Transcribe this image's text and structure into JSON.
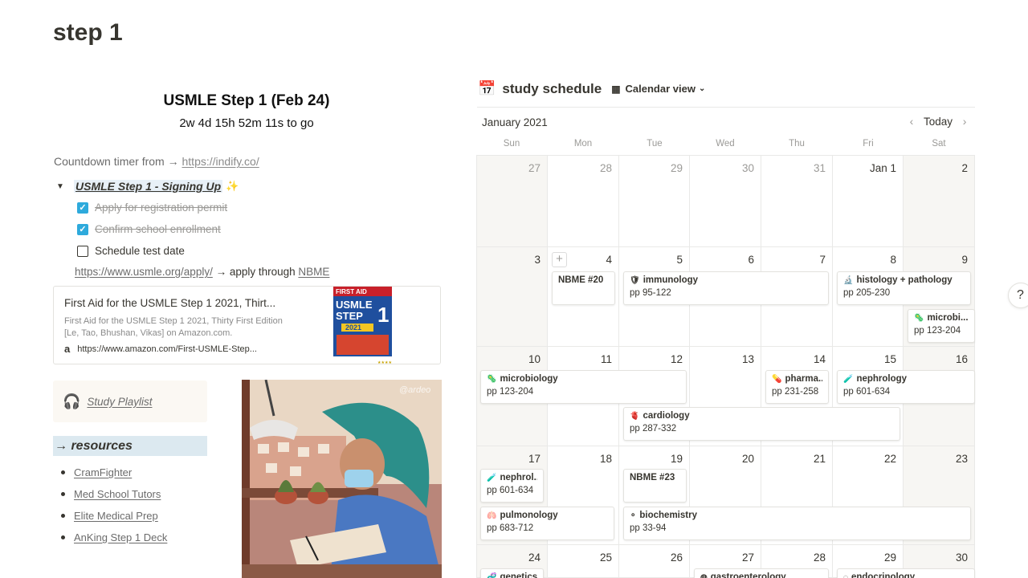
{
  "page": {
    "title": "step 1"
  },
  "countdown": {
    "title": "USMLE Step 1 (Feb 24)",
    "value": "2w 4d 15h 52m 11s to go",
    "source_prefix": "Countdown timer from → ",
    "source_link": "https://indify.co/"
  },
  "signup": {
    "toggle_label": "USMLE Step 1 - Signing Up",
    "toggle_icon": "sparkles-icon",
    "todos": [
      {
        "label": "Apply for registration permit",
        "checked": true
      },
      {
        "label": "Confirm school enrollment",
        "checked": true
      },
      {
        "label": "Schedule test date",
        "checked": false
      }
    ],
    "apply_link": "https://www.usmle.org/apply/",
    "apply_mid": " → apply through ",
    "apply_nbme": "NBME"
  },
  "bookmark": {
    "title": "First Aid for the USMLE Step 1 2021, Thirt...",
    "description": "First Aid for the USMLE Step 1 2021, Thirty First Edition [Le, Tao, Bhushan, Vikas] on Amazon.com.",
    "url": "https://www.amazon.com/First-USMLE-Step...",
    "cover_top": "FIRST AID",
    "cover_mid": "USMLE",
    "cover_step": "STEP",
    "cover_num": "1",
    "cover_year": "2021"
  },
  "playlist": {
    "label": "Study Playlist",
    "icon": "headphones-icon"
  },
  "resources": {
    "heading": "→ resources",
    "items": [
      "CramFighter",
      "Med School Tutors",
      "Elite Medical Prep",
      "AnKing Step 1 Deck"
    ]
  },
  "artwork": {
    "signature": "@ardeo"
  },
  "calendar": {
    "db_title": "study schedule",
    "view_label": "Calendar view",
    "month": "January 2021",
    "today_label": "Today",
    "weekdays": [
      "Sun",
      "Mon",
      "Tue",
      "Wed",
      "Thu",
      "Fri",
      "Sat"
    ],
    "weeks": [
      [
        "27",
        "28",
        "29",
        "30",
        "31",
        "Jan 1",
        "2"
      ],
      [
        "3",
        "4",
        "5",
        "6",
        "7",
        "8",
        "9"
      ],
      [
        "10",
        "11",
        "12",
        "13",
        "14",
        "15",
        "16"
      ],
      [
        "17",
        "18",
        "19",
        "20",
        "21",
        "22",
        "23"
      ],
      [
        "24",
        "25",
        "26",
        "27",
        "28",
        "29",
        "30"
      ]
    ],
    "events": [
      {
        "title": "NBME #20",
        "pages": ""
      },
      {
        "title": "immunology",
        "pages": "pp 95-122",
        "icon": "shield-icon"
      },
      {
        "title": "histology + pathology",
        "pages": "pp 205-230",
        "icon": "microscope-icon"
      },
      {
        "title": "microbi...",
        "pages": "pp 123-204",
        "icon": "microbe-icon"
      },
      {
        "title": "microbiology",
        "pages": "pp 123-204",
        "icon": "microbe-icon"
      },
      {
        "title": "pharma...",
        "pages": "pp 231-258",
        "icon": "pill-icon"
      },
      {
        "title": "nephrology",
        "pages": "pp 601-634",
        "icon": "test-tube-icon"
      },
      {
        "title": "cardiology",
        "pages": "pp 287-332",
        "icon": "heart-icon"
      },
      {
        "title": "nephrol...",
        "pages": "pp 601-634",
        "icon": "test-tube-icon"
      },
      {
        "title": "NBME #23",
        "pages": ""
      },
      {
        "title": "pulmonology",
        "pages": "pp 683-712",
        "icon": "lungs-icon"
      },
      {
        "title": "biochemistry",
        "pages": "pp 33-94",
        "icon": "molecule-icon"
      },
      {
        "title": "genetics",
        "pages": "",
        "icon": "dna-icon"
      },
      {
        "title": "gastroenterology",
        "pages": "",
        "icon": "stomach-icon"
      },
      {
        "title": "endocrinology",
        "pages": "",
        "icon": "gland-icon"
      }
    ]
  },
  "help": {
    "label": "?"
  }
}
